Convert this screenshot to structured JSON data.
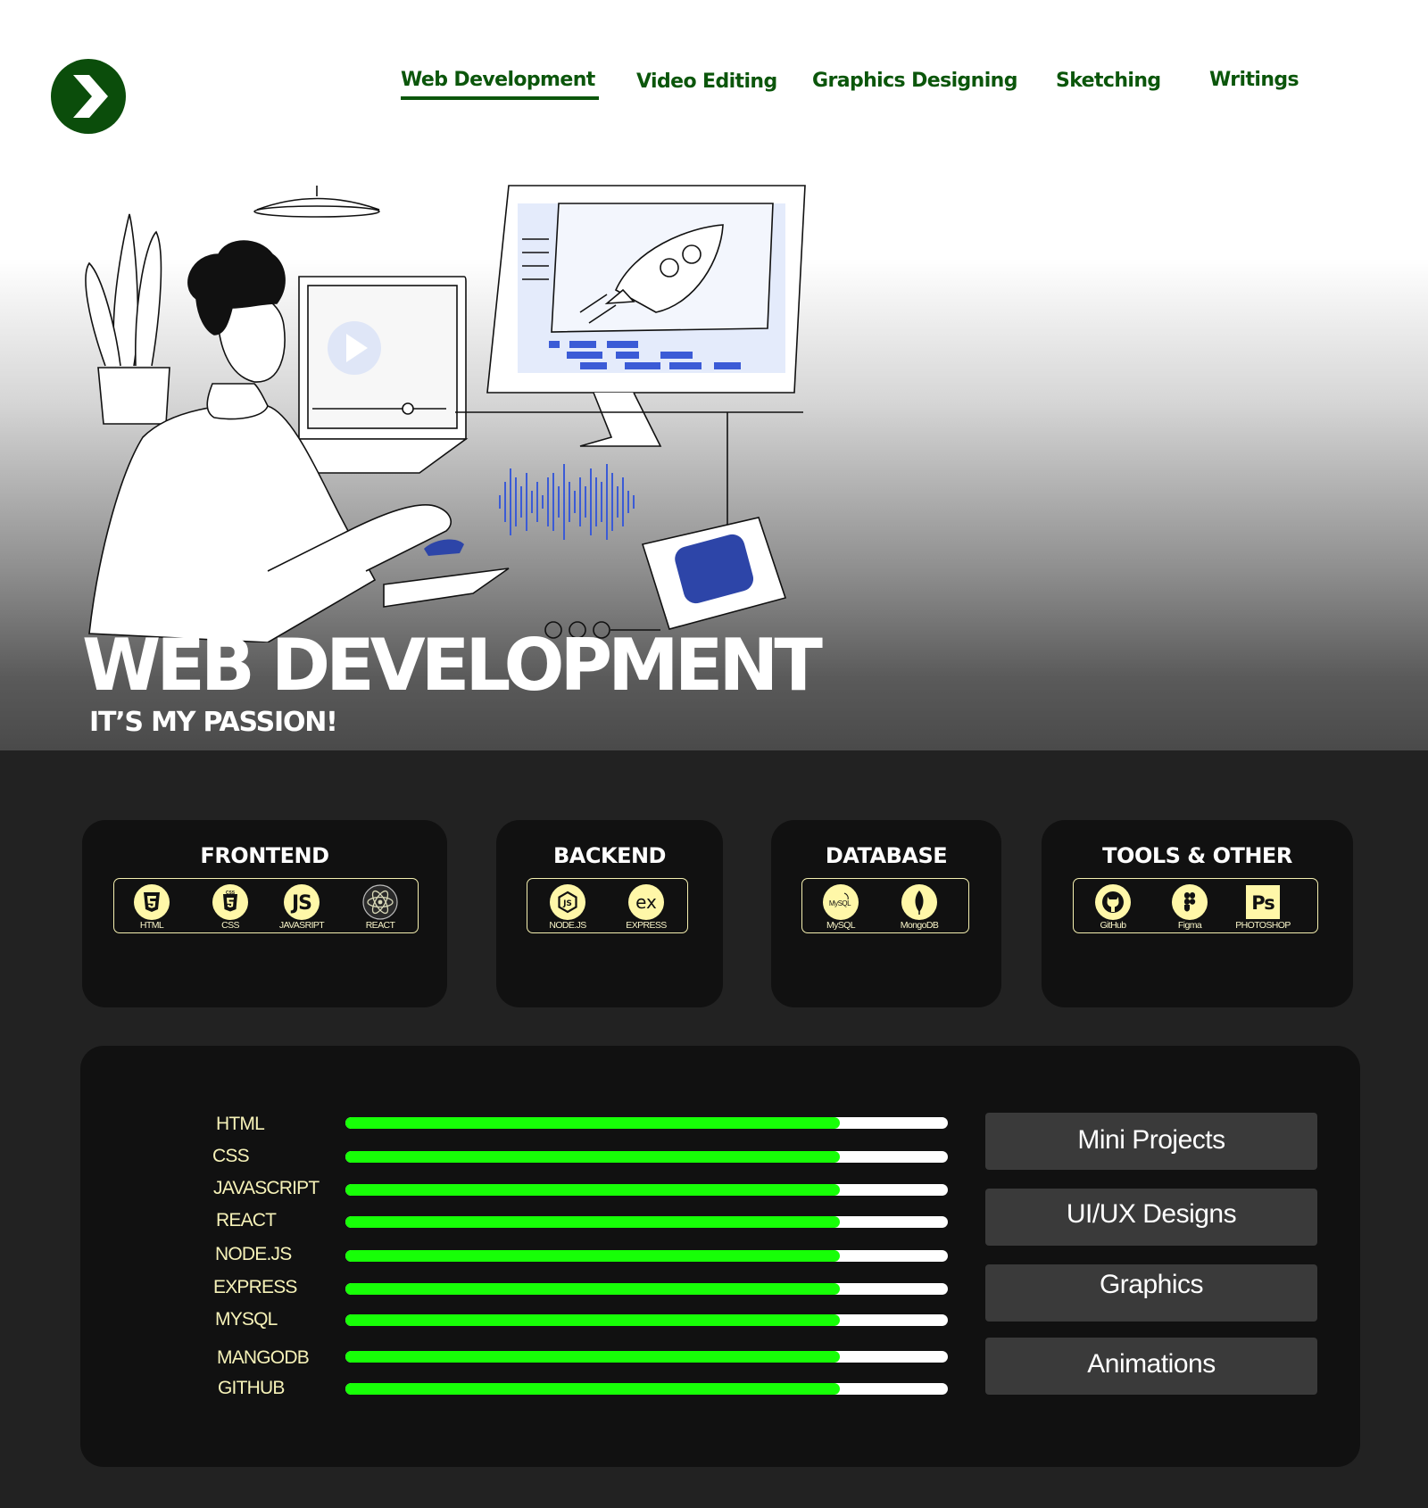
{
  "nav": {
    "items": [
      {
        "label": "Web Development",
        "active": true
      },
      {
        "label": "Video Editing",
        "active": false
      },
      {
        "label": "Graphics Designing",
        "active": false
      },
      {
        "label": "Sketching",
        "active": false
      },
      {
        "label": "Writings",
        "active": false
      }
    ]
  },
  "logo": {
    "icon": "chevron-right-icon"
  },
  "hero": {
    "title": "WEB DEVELOPMENT",
    "subtitle": "IT’S MY PASSION!"
  },
  "skill_cards": [
    {
      "title": "FRONTEND",
      "items": [
        {
          "label": "HTML",
          "icon": "html5-icon"
        },
        {
          "label": "CSS",
          "icon": "css3-icon"
        },
        {
          "label": "JAVASRIPT",
          "icon": "javascript-icon"
        },
        {
          "label": "REACT",
          "icon": "react-icon"
        }
      ]
    },
    {
      "title": "BACKEND",
      "items": [
        {
          "label": "NODE.JS",
          "icon": "nodejs-icon"
        },
        {
          "label": "EXPRESS",
          "icon": "express-icon"
        }
      ]
    },
    {
      "title": "DATABASE",
      "items": [
        {
          "label": "MySQL",
          "icon": "mysql-icon"
        },
        {
          "label": "MongoDB",
          "icon": "mongodb-icon"
        }
      ]
    },
    {
      "title": "TOOLS & OTHER",
      "items": [
        {
          "label": "GitHub",
          "icon": "github-icon"
        },
        {
          "label": "Figma",
          "icon": "figma-icon"
        },
        {
          "label": "PHOTOSHOP",
          "icon": "photoshop-icon"
        }
      ]
    }
  ],
  "skills": [
    {
      "label": "HTML",
      "level": 0.82
    },
    {
      "label": "CSS",
      "level": 0.82
    },
    {
      "label": "JAVASCRIPT",
      "level": 0.82
    },
    {
      "label": "REACT",
      "level": 0.82
    },
    {
      "label": "NODE.JS",
      "level": 0.82
    },
    {
      "label": "EXPRESS",
      "level": 0.82
    },
    {
      "label": "MYSQL",
      "level": 0.82
    },
    {
      "label": "MANGODB",
      "level": 0.82
    },
    {
      "label": "GITHUB",
      "level": 0.82
    }
  ],
  "side_buttons": [
    {
      "label": "Mini Projects"
    },
    {
      "label": "UI/UX Designs"
    },
    {
      "label": "Graphics"
    },
    {
      "label": "Animations"
    }
  ],
  "colors": {
    "brand_green": "#0b560b",
    "bar_fill": "#17ff07",
    "label_yellow": "#f6f2b8",
    "card_bg": "#111111",
    "page_bg": "#222222"
  }
}
